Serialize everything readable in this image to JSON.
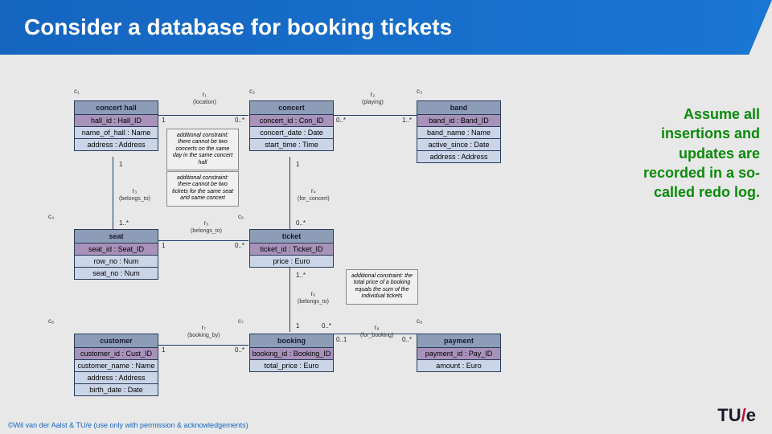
{
  "title": "Consider a database for booking tickets",
  "sidenote": "Assume all insertions and updates are recorded in a so-called redo log.",
  "footer": "©Wil van der Aalst & TU/e (use only with permission & acknowledgements)",
  "logo": {
    "text": "TU",
    "slash": "/",
    "e": "e"
  },
  "entities": {
    "c1": {
      "label": "c₁",
      "name": "concert hall",
      "pk": "hall_id : Hall_ID",
      "attrs": [
        "name_of_hall : Name",
        "address : Address"
      ]
    },
    "c2": {
      "label": "c₂",
      "name": "concert",
      "pk": "concert_id : Con_ID",
      "attrs": [
        "concert_date : Date",
        "start_time : Time"
      ]
    },
    "c3": {
      "label": "c₃",
      "name": "band",
      "pk": "band_id : Band_ID",
      "attrs": [
        "band_name : Name",
        "active_since : Date",
        "address : Address"
      ]
    },
    "c4": {
      "label": "c₄",
      "name": "seat",
      "pk": "seat_id : Seat_ID",
      "attrs": [
        "row_no : Num",
        "seat_no : Num"
      ]
    },
    "c5": {
      "label": "c₅",
      "name": "ticket",
      "pk": "ticket_id : Ticket_ID",
      "attrs": [
        "price : Euro"
      ]
    },
    "c6": {
      "label": "c₆",
      "name": "customer",
      "pk": "customer_id : Cust_ID",
      "attrs": [
        "customer_name : Name",
        "address : Address",
        "birth_date : Date"
      ]
    },
    "c7": {
      "label": "c₇",
      "name": "booking",
      "pk": "booking_id : Booking_ID",
      "attrs": [
        "total_price : Euro"
      ]
    },
    "c8": {
      "label": "c₈",
      "name": "payment",
      "pk": "payment_id : Pay_ID",
      "attrs": [
        "amount : Euro"
      ]
    }
  },
  "relations": {
    "r1": {
      "name": "r₁",
      "sub": "(location)",
      "left": "1",
      "right": "0..*"
    },
    "r2": {
      "name": "r₂",
      "sub": "(playing)",
      "left": "0..*",
      "right": "1..*"
    },
    "r3": {
      "name": "r₃",
      "sub": "(belongs_to)",
      "top": "1",
      "bot": "1..*"
    },
    "r4": {
      "name": "r₄",
      "sub": "(for_concert)",
      "top": "1",
      "bot": "0..*"
    },
    "r5": {
      "name": "r₅",
      "sub": "(belongs_to)",
      "left": "1",
      "right": "0..*"
    },
    "r6": {
      "name": "r₆",
      "sub": "(belongs_to)",
      "top": "1..*",
      "bot": "1"
    },
    "r7": {
      "name": "r₇",
      "sub": "(booking_by)",
      "left": "1",
      "right": "0..*"
    },
    "r8": {
      "name": "r₈",
      "sub": "(for_booking)",
      "left": "0..1",
      "right": "0..*",
      "mid": "0..*"
    }
  },
  "notes": {
    "n1": "additional constraint: there cannot be two concerts on the same day in the same concert hall",
    "n2": "additional constraint: there cannot be two tickets for the same seat and same concert",
    "n3": "additional constraint: the total price of a booking equals the sum of the individual tickets"
  }
}
